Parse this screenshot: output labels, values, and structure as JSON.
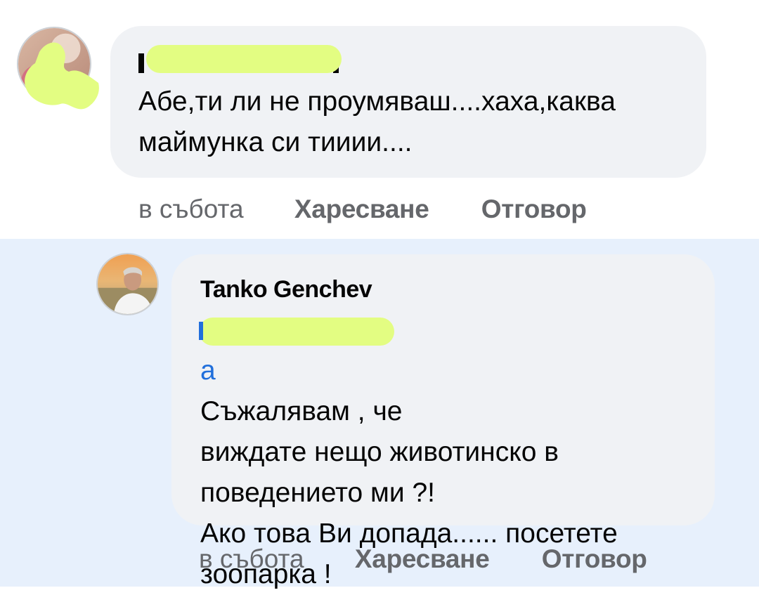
{
  "comment": {
    "author_name": "",
    "text_lines": [
      "Абе,ти ли не проумяваш....хаха,каква",
      "маймунка си тииии...."
    ],
    "time": "в събота",
    "like_label": "Харесване",
    "reply_label": "Отговор"
  },
  "reply": {
    "author_name": "Tanko Genchev",
    "mention_tail": "а",
    "text_line1": " Съжалявам , че",
    "text_lines": [
      "виждате нещо животинско в",
      "поведението ми ?!",
      "Ако това Ви допада...... посетете",
      "зоопарка !"
    ],
    "time": "в събота",
    "like_label": "Харесване",
    "reply_label": "Отговор"
  },
  "colors": {
    "bubble": "#f0f2f5",
    "reply_highlight_bg": "#e7f0fc",
    "mention": "#216fdb",
    "redaction": "#e3fd82",
    "secondary_text": "#65676b"
  }
}
